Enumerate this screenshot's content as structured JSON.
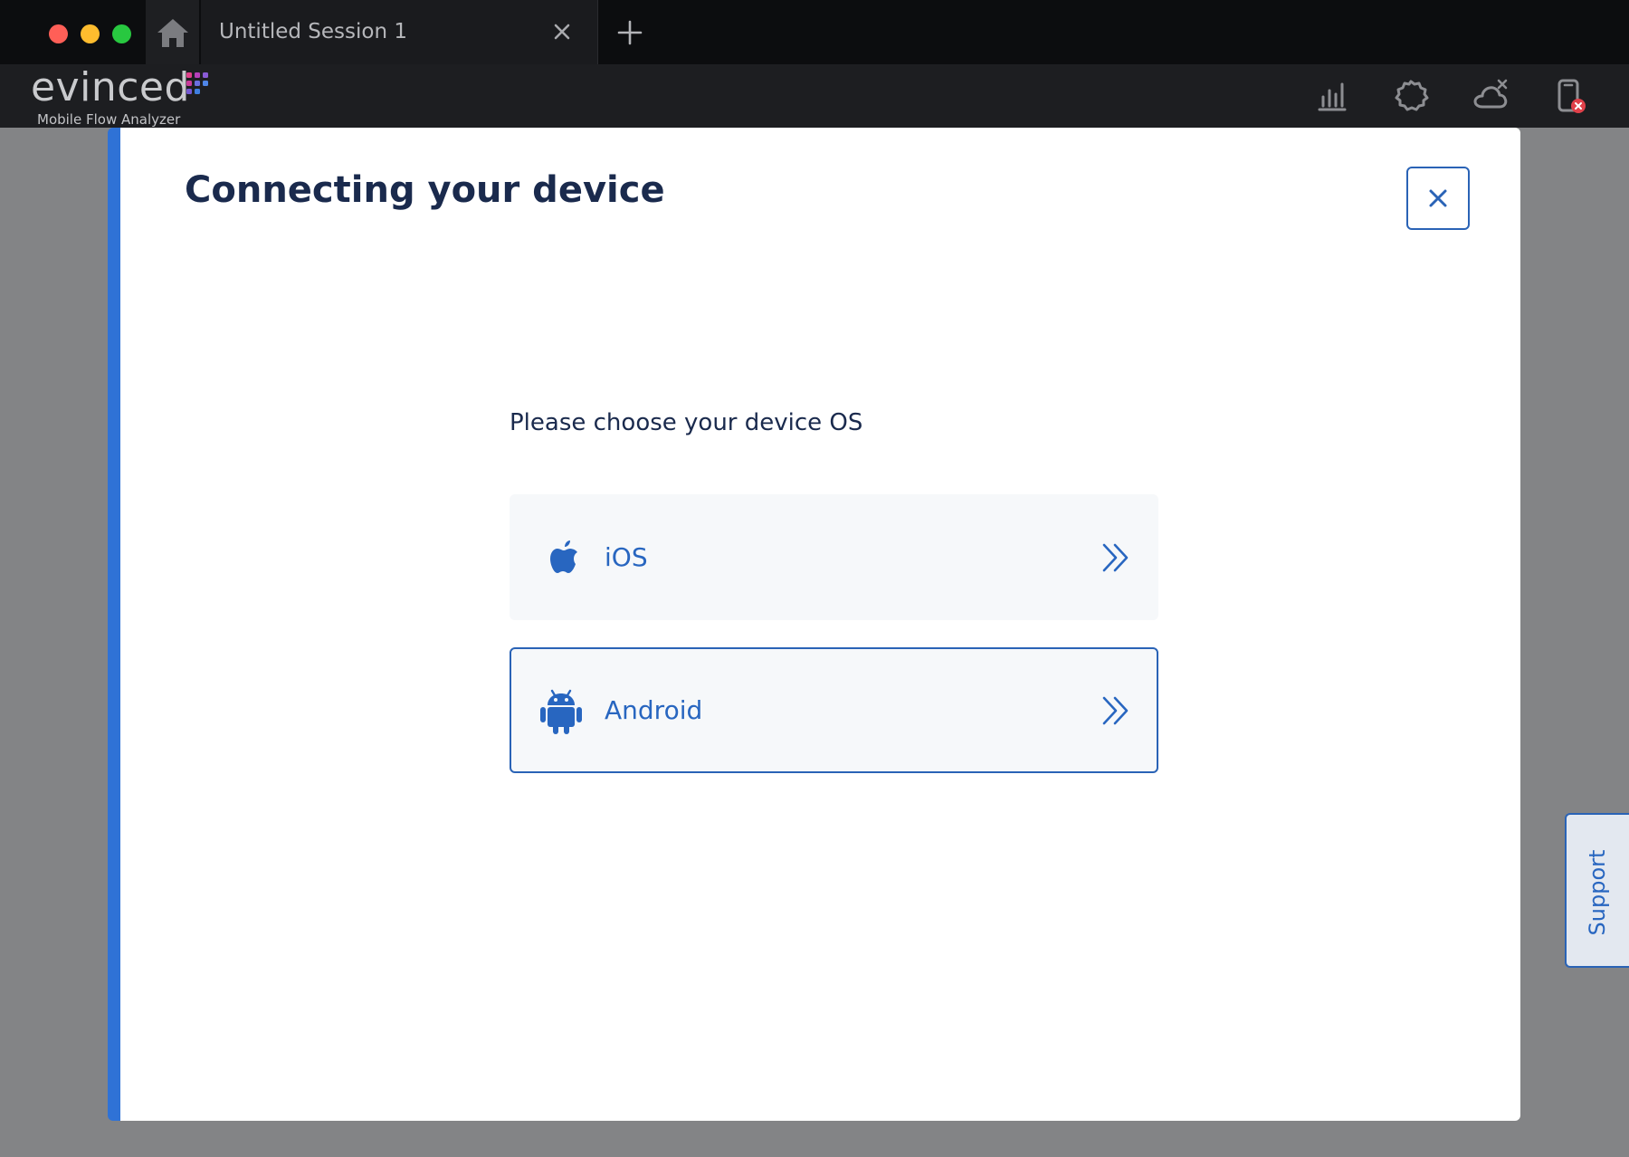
{
  "tabbar": {
    "session_tab_title": "Untitled Session 1"
  },
  "header": {
    "logo_text": "evinced",
    "logo_subtitle": "Mobile Flow Analyzer",
    "icons": [
      "bar-chart-icon",
      "settings-gear-icon",
      "cloud-disconnected-icon",
      "device-disconnected-icon"
    ]
  },
  "modal": {
    "title": "Connecting your device",
    "prompt": "Please choose your device OS",
    "options": [
      {
        "label": "iOS",
        "icon": "apple-icon",
        "selected": false
      },
      {
        "label": "Android",
        "icon": "android-icon",
        "selected": true
      }
    ]
  },
  "support": {
    "label": "Support"
  },
  "colors": {
    "accent": "#2f72d6",
    "text_dark": "#1a2a4d",
    "link_blue": "#2866c0"
  }
}
